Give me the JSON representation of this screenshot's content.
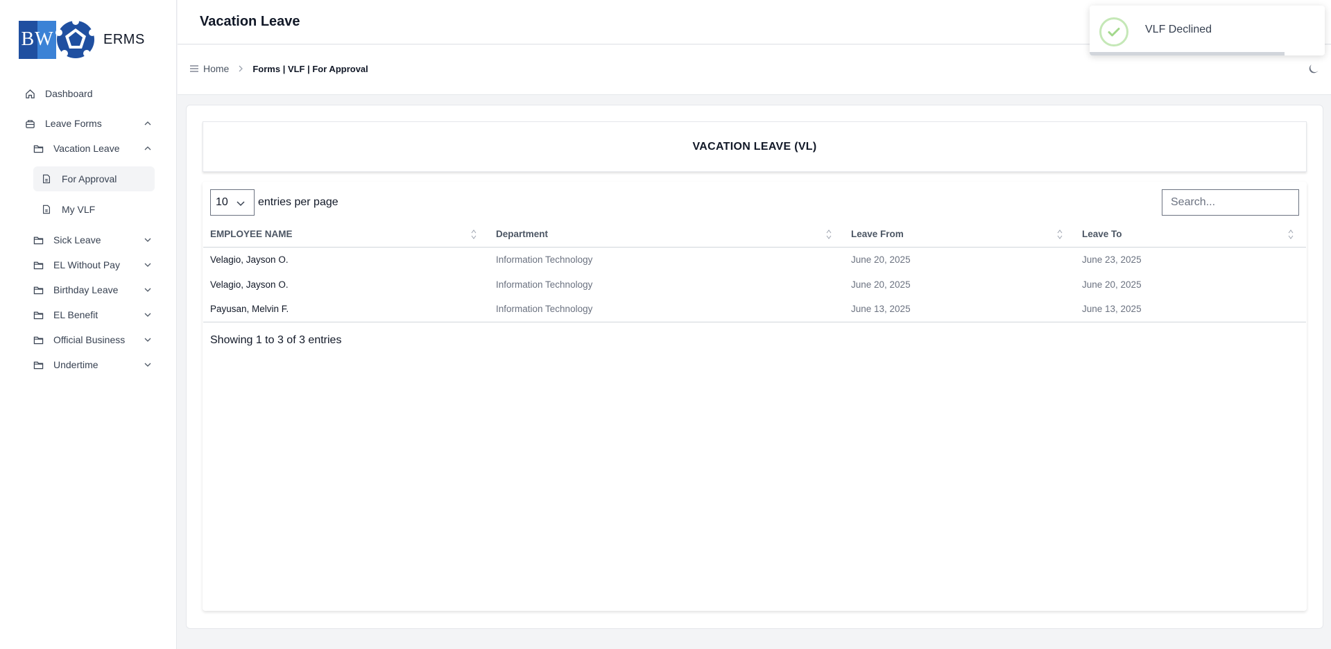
{
  "brand": {
    "logo_text": "BW",
    "name": "ERMS"
  },
  "sidebar": {
    "items": [
      {
        "label": "Dashboard",
        "icon": "home-icon"
      },
      {
        "label": "Leave Forms",
        "icon": "briefcase-icon"
      },
      {
        "label": "Vacation Leave",
        "icon": "folder-icon"
      },
      {
        "label": "For Approval",
        "icon": "file-icon"
      },
      {
        "label": "My VLF",
        "icon": "file-icon"
      },
      {
        "label": "Sick Leave",
        "icon": "folder-icon"
      },
      {
        "label": "EL Without Pay",
        "icon": "folder-icon"
      },
      {
        "label": "Birthday Leave",
        "icon": "folder-icon"
      },
      {
        "label": "EL Benefit",
        "icon": "folder-icon"
      },
      {
        "label": "Official Business",
        "icon": "folder-icon"
      },
      {
        "label": "Undertime",
        "icon": "folder-icon"
      }
    ]
  },
  "header": {
    "title": "Vacation Leave"
  },
  "breadcrumb": {
    "home": "Home",
    "current": "Forms | VLF | For Approval"
  },
  "toast": {
    "message": "VLF Declined",
    "progress": 0.83,
    "color": "#a3d98c"
  },
  "card": {
    "title": "VACATION LEAVE (VL)"
  },
  "table_controls": {
    "per_page": "10",
    "per_page_label": "entries per page",
    "search_placeholder": "Search..."
  },
  "table": {
    "headers": [
      "EMPLOYEE NAME",
      "Department",
      "Leave From",
      "Leave To"
    ],
    "rows": [
      [
        "Velagio, Jayson O.",
        "Information Technology",
        "June 20, 2025",
        "June 23, 2025"
      ],
      [
        "Velagio, Jayson O.",
        "Information Technology",
        "June 20, 2025",
        "June 20, 2025"
      ],
      [
        "Payusan, Melvin F.",
        "Information Technology",
        "June 13, 2025",
        "June 13, 2025"
      ]
    ],
    "footer": "Showing 1 to 3 of 3 entries"
  }
}
